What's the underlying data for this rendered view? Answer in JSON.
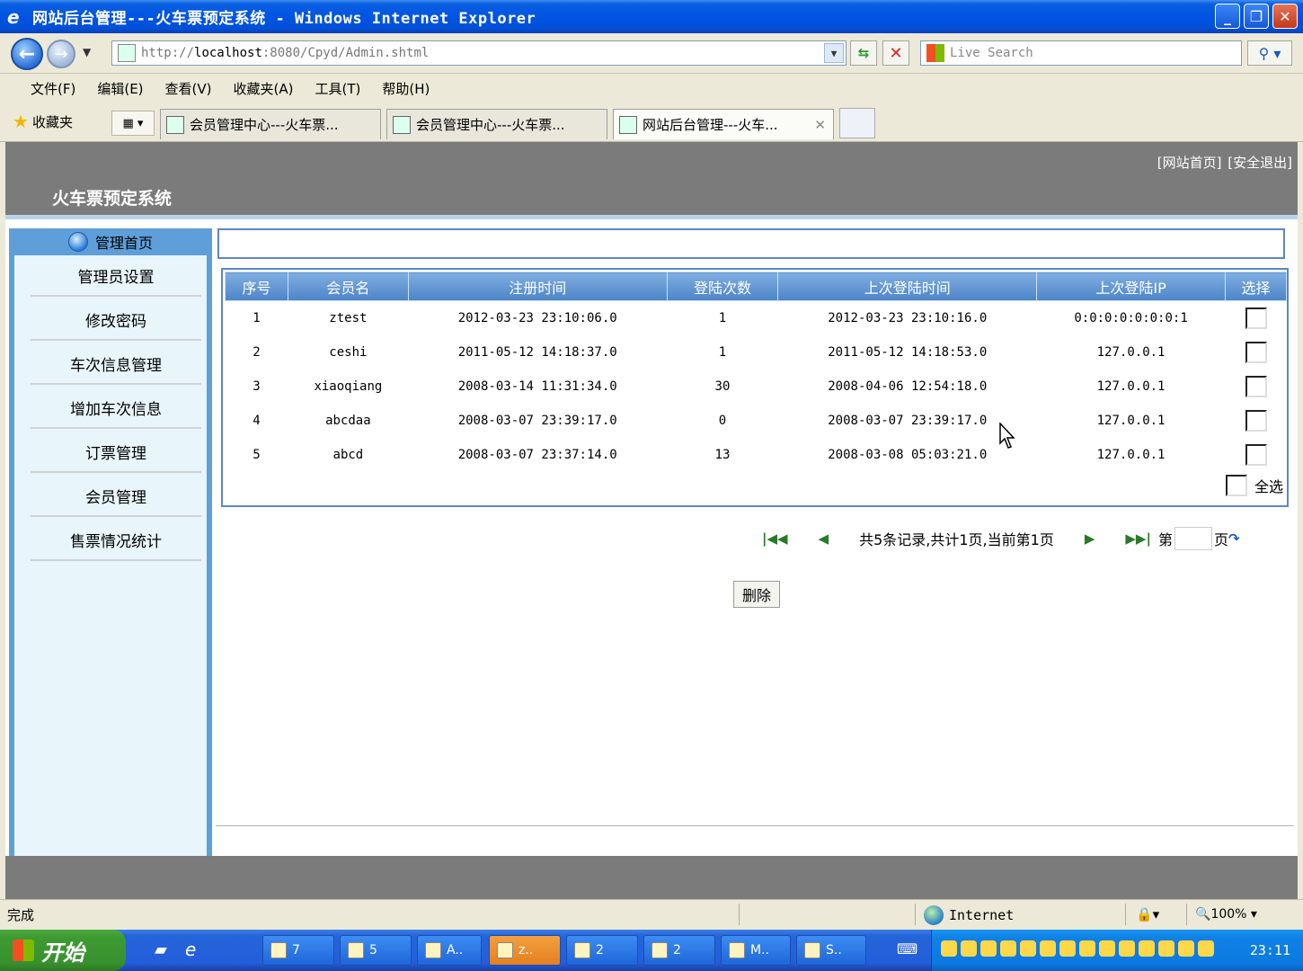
{
  "window": {
    "title": "网站后台管理---火车票预定系统 - Windows Internet Explorer",
    "min_label": "_",
    "max_label": "❐",
    "close_label": "✕"
  },
  "address": {
    "url_prefix": "http://",
    "url_host": "localhost",
    "url_rest": ":8080/Cpyd/Admin.shtml",
    "search_placeholder": "Live Search"
  },
  "menu": [
    "文件(F)",
    "编辑(E)",
    "查看(V)",
    "收藏夹(A)",
    "工具(T)",
    "帮助(H)"
  ],
  "favorites_label": "收藏夹",
  "tabs": [
    {
      "label": "会员管理中心---火车票..."
    },
    {
      "label": "会员管理中心---火车票..."
    },
    {
      "label": "网站后台管理---火车..."
    }
  ],
  "header": {
    "home_link": "[网站首页]",
    "logout_link": "[安全退出]",
    "site_title": "火车票预定系统"
  },
  "sidebar": {
    "head": "管理首页",
    "items": [
      "管理员设置",
      "修改密码",
      "车次信息管理",
      "增加车次信息",
      "订票管理",
      "会员管理",
      "售票情况统计"
    ]
  },
  "table": {
    "columns": [
      "序号",
      "会员名",
      "注册时间",
      "登陆次数",
      "上次登陆时间",
      "上次登陆IP",
      "选择"
    ],
    "rows": [
      [
        "1",
        "ztest",
        "2012-03-23 23:10:06.0",
        "1",
        "2012-03-23 23:10:16.0",
        "0:0:0:0:0:0:0:1"
      ],
      [
        "2",
        "ceshi",
        "2011-05-12 14:18:37.0",
        "1",
        "2011-05-12 14:18:53.0",
        "127.0.0.1"
      ],
      [
        "3",
        "xiaoqiang",
        "2008-03-14 11:31:34.0",
        "30",
        "2008-04-06 12:54:18.0",
        "127.0.0.1"
      ],
      [
        "4",
        "abcdaa",
        "2008-03-07 23:39:17.0",
        "0",
        "2008-03-07 23:39:17.0",
        "127.0.0.1"
      ],
      [
        "5",
        "abcd",
        "2008-03-07 23:37:14.0",
        "13",
        "2008-03-08 05:03:21.0",
        "127.0.0.1"
      ]
    ],
    "select_all": "全选"
  },
  "pager": {
    "first": "|◀◀",
    "prev": "◀",
    "summary": "共5条记录,共计1页,当前第1页",
    "next": "▶",
    "last": "▶▶|",
    "page_prefix": "第",
    "page_suffix": "页",
    "go": "↷"
  },
  "delete_label": "删除",
  "status": {
    "done": "完成",
    "zone": "Internet",
    "zoom": "100%"
  },
  "taskbar": {
    "start": "开始",
    "tasks": [
      "7",
      "5",
      "A..",
      "z..",
      "2",
      "2",
      "M..",
      "S.."
    ],
    "clock": "23:11"
  }
}
